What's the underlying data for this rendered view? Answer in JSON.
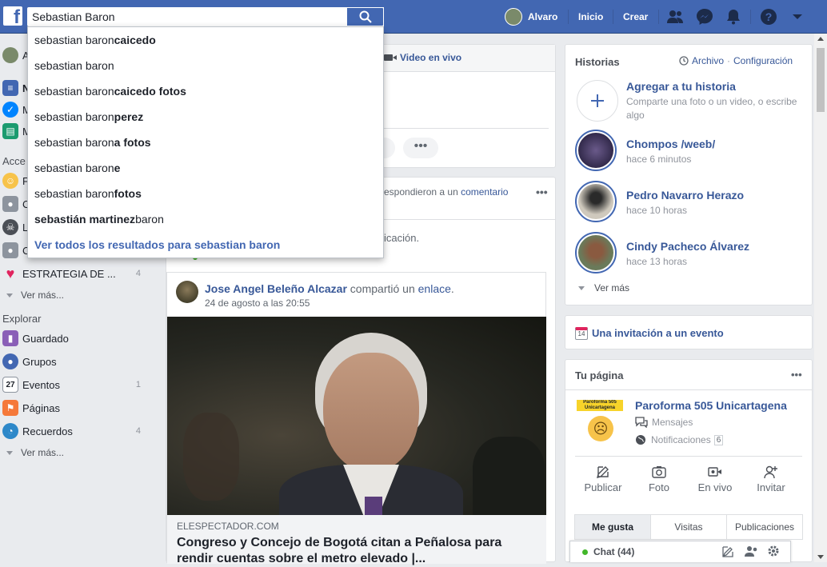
{
  "topbar": {
    "logo": "f",
    "search_value": "Sebastian Baron",
    "user_name": "Alvaro",
    "home": "Inicio",
    "create": "Crear"
  },
  "search_suggestions": {
    "items": [
      {
        "prefix": "sebastian baron ",
        "bold": "caicedo"
      },
      {
        "prefix": "sebastian baron",
        "bold": ""
      },
      {
        "prefix": "sebastian baron ",
        "bold": "caicedo fotos"
      },
      {
        "prefix": "sebastian baron ",
        "bold": "perez"
      },
      {
        "prefix": "sebastian baron",
        "bold": "a fotos"
      },
      {
        "prefix": "sebastian baron",
        "bold": "e"
      },
      {
        "prefix": "sebastian baron ",
        "bold": "fotos"
      },
      {
        "prefix": " baron",
        "bold": "sebastián martinez"
      }
    ],
    "see_all": "Ver todos los resultados para sebastian baron"
  },
  "left": {
    "partial_rows": [
      "A",
      "N",
      "M",
      "M"
    ],
    "shortcuts_head": "Acce",
    "shortcut_partials": [
      "F",
      "C",
      "L",
      "C"
    ],
    "strategy": "ESTRATEGIA DE ...",
    "strategy_count": "4",
    "see_more": "Ver más...",
    "explore_head": "Explorar",
    "explore": [
      {
        "label": "Guardado",
        "count": ""
      },
      {
        "label": "Grupos",
        "count": ""
      },
      {
        "label": "Eventos",
        "count": "1"
      },
      {
        "label": "Páginas",
        "count": ""
      },
      {
        "label": "Recuerdos",
        "count": "4"
      }
    ],
    "see_more_2": "Ver más..."
  },
  "composer": {
    "live_video": "Video en vivo"
  },
  "feed": {
    "notif_text_a": "respondieron a un ",
    "notif_link": "comentario",
    "notif_text_b": "icación.",
    "post": {
      "author": "Jose Angel Beleño Alcazar",
      "action_a": " compartió un ",
      "action_link": "enlace",
      "action_b": ".",
      "time": "24 de agosto a las 20:55",
      "source": "ELESPECTADOR.COM",
      "headline": "Congreso y Concejo de Bogotá citan a Peñalosa para rendir cuentas sobre el metro elevado |..."
    }
  },
  "stories": {
    "title": "Historias",
    "archive": "Archivo",
    "dot": "·",
    "config": "Configuración",
    "add_title": "Agregar a tu historia",
    "add_sub": "Comparte una foto o un video, o escribe algo",
    "items": [
      {
        "name": "Chompos /weeb/",
        "time": "hace 6 minutos"
      },
      {
        "name": "Pedro Navarro Herazo",
        "time": "hace 10 horas"
      },
      {
        "name": "Cindy Pacheco Álvarez",
        "time": "hace 13 horas"
      }
    ],
    "see_more": "Ver más"
  },
  "event": {
    "icon_num": "14",
    "label": "Una invitación a un evento"
  },
  "your_page": {
    "title": "Tu página",
    "name": "Paroforma 505 Unicartagena",
    "logo_text": "Paroforma 505 Unicartagena",
    "messages": "Mensajes",
    "notifications": "Notificaciones",
    "notif_count": "6",
    "actions": [
      "Publicar",
      "Foto",
      "En vivo",
      "Invitar"
    ],
    "tabs": [
      "Me gusta",
      "Visitas",
      "Publicaciones"
    ]
  },
  "chat": {
    "label": "Chat (44)"
  },
  "colors": {
    "brand": "#4267b2",
    "link": "#385898",
    "online": "#42b72a"
  }
}
